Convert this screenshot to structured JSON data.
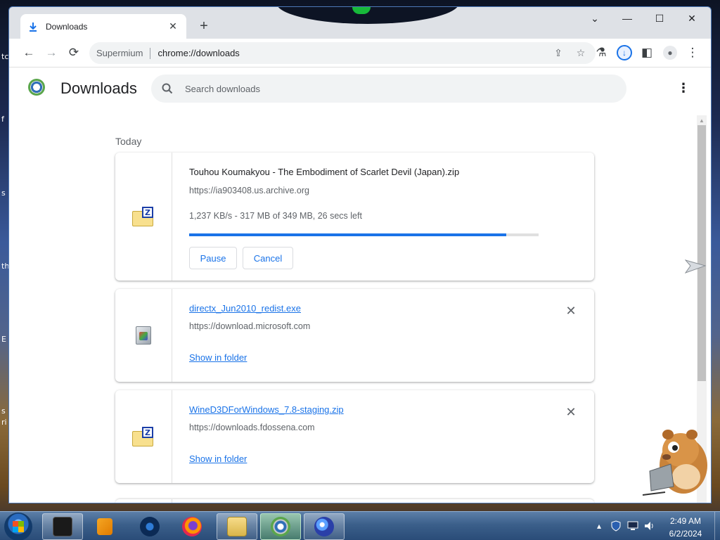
{
  "tab": {
    "title": "Downloads",
    "close": "✕",
    "new": "+"
  },
  "caption": {
    "dropdown": "⌄",
    "minimize": "—",
    "maximize": "☐",
    "close": "✕"
  },
  "toolbar": {
    "back": "←",
    "forward": "→",
    "reload": "⟳",
    "host_label": "Supermium",
    "url": "chrome://downloads",
    "share": "⇪",
    "star": "☆",
    "labs": "⚗",
    "download": "↓",
    "sidepanel": "◧",
    "profile": "●",
    "menu": "⋮"
  },
  "page": {
    "title": "Downloads",
    "search_placeholder": "Search downloads",
    "menu": "⋮",
    "section": "Today"
  },
  "downloads": [
    {
      "icon": "zip-folder-icon",
      "filename": "Touhou Koumakyou - The Embodiment of Scarlet Devil (Japan).zip",
      "source": "https://ia903408.us.archive.org",
      "status": "1,237 KB/s - 317 MB of 349 MB, 26 secs left",
      "progress": 0.908,
      "pause_label": "Pause",
      "cancel_label": "Cancel"
    },
    {
      "icon": "installer-exe-icon",
      "filename": "directx_Jun2010_redist.exe",
      "source": "https://download.microsoft.com",
      "action_label": "Show in folder",
      "remove": "✕"
    },
    {
      "icon": "zip-folder-icon",
      "filename": "WineD3DForWindows_7.8-staging.zip",
      "source": "https://downloads.fdossena.com",
      "action_label": "Show in folder",
      "remove": "✕"
    }
  ],
  "taskbar": {
    "clock_time": "2:49 AM",
    "clock_date": "6/2/2024",
    "tray_chevron": "▴"
  },
  "desktop_glyphs": [
    "tc",
    "f",
    "s",
    "th",
    "E",
    "s",
    "ri"
  ],
  "colors": {
    "accent": "#1a73e8",
    "progress_track": "#e0e0e0",
    "taskbar": "#3b5f8a"
  }
}
